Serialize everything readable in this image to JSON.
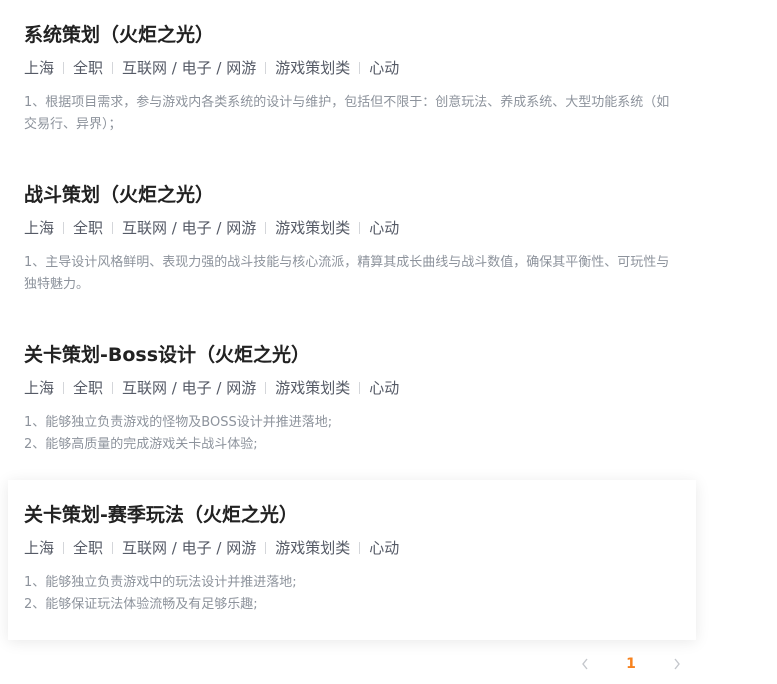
{
  "jobs": [
    {
      "title": "系统策划（火炬之光）",
      "tags": [
        "上海",
        "全职",
        "互联网 / 电子 / 网游",
        "游戏策划类",
        "心动"
      ],
      "desc": [
        "1、根据项目需求，参与游戏内各类系统的设计与维护，包括但不限于：创意玩法、养成系统、大型功能系统（如交易行、异界）；"
      ]
    },
    {
      "title": "战斗策划（火炬之光）",
      "tags": [
        "上海",
        "全职",
        "互联网 / 电子 / 网游",
        "游戏策划类",
        "心动"
      ],
      "desc": [
        "1、主导设计风格鲜明、表现力强的战斗技能与核心流派，精算其成长曲线与战斗数值，确保其平衡性、可玩性与独特魅力。"
      ]
    },
    {
      "title": "关卡策划-Boss设计（火炬之光）",
      "tags": [
        "上海",
        "全职",
        "互联网 / 电子 / 网游",
        "游戏策划类",
        "心动"
      ],
      "desc": [
        "1、能够独立负责游戏的怪物及BOSS设计并推进落地;",
        "2、能够高质量的完成游戏关卡战斗体验;"
      ]
    },
    {
      "title": "关卡策划-赛季玩法（火炬之光）",
      "tags": [
        "上海",
        "全职",
        "互联网 / 电子 / 网游",
        "游戏策划类",
        "心动"
      ],
      "desc": [
        "1、能够独立负责游戏中的玩法设计并推进落地;",
        "2、能够保证玩法体验流畅及有足够乐趣;"
      ]
    }
  ],
  "pagination": {
    "prev_icon": "chevron-left-icon",
    "next_icon": "chevron-right-icon",
    "current_page": "1"
  }
}
